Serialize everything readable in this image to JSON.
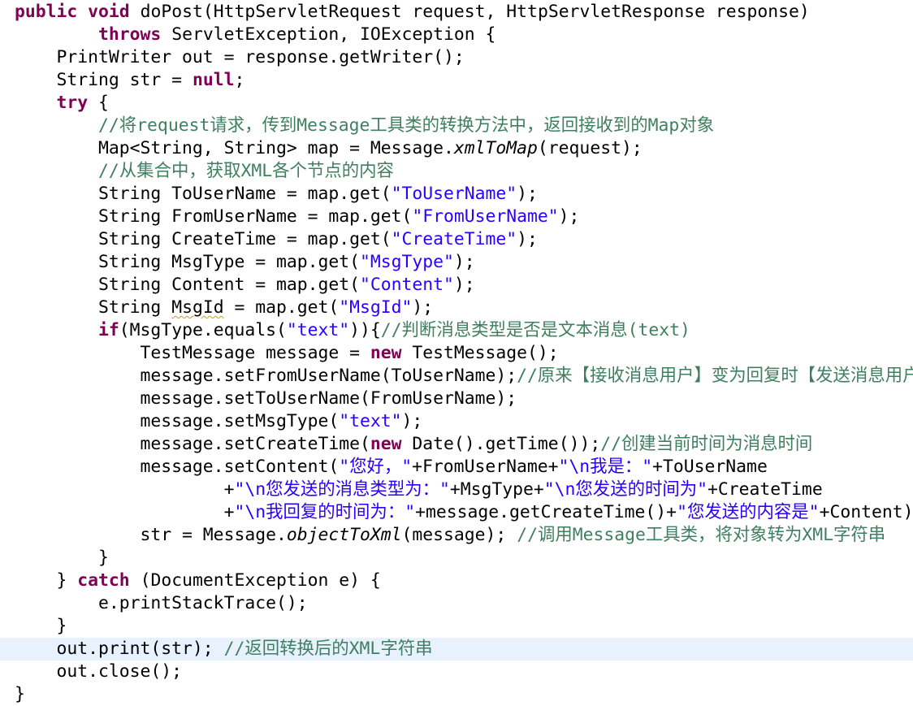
{
  "editor": {
    "language": "java",
    "current_line": 28,
    "colors": {
      "keyword": "#7f0055",
      "string": "#2a00ff",
      "comment": "#3f7f5f",
      "plain": "#000000",
      "current_line_bg": "#e8f2fe"
    },
    "lines": [
      [
        {
          "c": "kw",
          "t": "public"
        },
        {
          "t": " "
        },
        {
          "c": "kw",
          "t": "void"
        },
        {
          "t": " doPost(HttpServletRequest request, HttpServletResponse response)"
        }
      ],
      [
        {
          "t": "        "
        },
        {
          "c": "kw",
          "t": "throws"
        },
        {
          "t": " ServletException, IOException {"
        }
      ],
      [
        {
          "t": "    PrintWriter out = response.getWriter();"
        }
      ],
      [
        {
          "t": "    String str = "
        },
        {
          "c": "kw",
          "t": "null"
        },
        {
          "t": ";"
        }
      ],
      [
        {
          "t": "    "
        },
        {
          "c": "kw",
          "t": "try"
        },
        {
          "t": " {"
        }
      ],
      [
        {
          "t": "        "
        },
        {
          "c": "cmt",
          "t": "//将request请求，传到Message工具类的转换方法中，返回接收到的Map对象"
        }
      ],
      [
        {
          "t": "        Map<String, String> map = Message."
        },
        {
          "c": "it",
          "t": "xmlToMap"
        },
        {
          "t": "(request);"
        }
      ],
      [
        {
          "t": "        "
        },
        {
          "c": "cmt",
          "t": "//从集合中，获取XML各个节点的内容"
        }
      ],
      [
        {
          "t": "        String ToUserName = map.get("
        },
        {
          "c": "str",
          "t": "\"ToUserName\""
        },
        {
          "t": ");"
        }
      ],
      [
        {
          "t": "        String FromUserName = map.get("
        },
        {
          "c": "str",
          "t": "\"FromUserName\""
        },
        {
          "t": ");"
        }
      ],
      [
        {
          "t": "        String CreateTime = map.get("
        },
        {
          "c": "str",
          "t": "\"CreateTime\""
        },
        {
          "t": ");"
        }
      ],
      [
        {
          "t": "        String MsgType = map.get("
        },
        {
          "c": "str",
          "t": "\"MsgType\""
        },
        {
          "t": ");"
        }
      ],
      [
        {
          "t": "        String Content = map.get("
        },
        {
          "c": "str",
          "t": "\"Content\""
        },
        {
          "t": ");"
        }
      ],
      [
        {
          "t": "        String "
        },
        {
          "c": "warn",
          "t": "MsgId"
        },
        {
          "t": " = map.get("
        },
        {
          "c": "str",
          "t": "\"MsgId\""
        },
        {
          "t": ");"
        }
      ],
      [
        {
          "t": "        "
        },
        {
          "c": "kw",
          "t": "if"
        },
        {
          "t": "(MsgType.equals("
        },
        {
          "c": "str",
          "t": "\"text\""
        },
        {
          "t": ")){"
        },
        {
          "c": "cmt",
          "t": "//判断消息类型是否是文本消息(text)"
        }
      ],
      [
        {
          "t": "            TestMessage message = "
        },
        {
          "c": "kw",
          "t": "new"
        },
        {
          "t": " TestMessage();"
        }
      ],
      [
        {
          "t": "            message.setFromUserName(ToUserName);"
        },
        {
          "c": "cmt",
          "t": "//原来【接收消息用户】变为回复时【发送消息用户】"
        }
      ],
      [
        {
          "t": "            message.setToUserName(FromUserName);"
        }
      ],
      [
        {
          "t": "            message.setMsgType("
        },
        {
          "c": "str",
          "t": "\"text\""
        },
        {
          "t": ");"
        }
      ],
      [
        {
          "t": "            message.setCreateTime("
        },
        {
          "c": "kw",
          "t": "new"
        },
        {
          "t": " Date().getTime());"
        },
        {
          "c": "cmt",
          "t": "//创建当前时间为消息时间"
        }
      ],
      [
        {
          "t": "            message.setContent("
        },
        {
          "c": "str",
          "t": "\"您好，\""
        },
        {
          "t": "+FromUserName+"
        },
        {
          "c": "str",
          "t": "\"\\n我是：\""
        },
        {
          "t": "+ToUserName"
        }
      ],
      [
        {
          "t": "                    +"
        },
        {
          "c": "str",
          "t": "\"\\n您发送的消息类型为：\""
        },
        {
          "t": "+MsgType+"
        },
        {
          "c": "str",
          "t": "\"\\n您发送的时间为\""
        },
        {
          "t": "+CreateTime"
        }
      ],
      [
        {
          "t": "                    +"
        },
        {
          "c": "str",
          "t": "\"\\n我回复的时间为：\""
        },
        {
          "t": "+message.getCreateTime()+"
        },
        {
          "c": "str",
          "t": "\"您发送的内容是\""
        },
        {
          "t": "+Content);"
        }
      ],
      [
        {
          "t": "            str = Message."
        },
        {
          "c": "it",
          "t": "objectToXml"
        },
        {
          "t": "(message); "
        },
        {
          "c": "cmt",
          "t": "//调用Message工具类，将对象转为XML字符串"
        }
      ],
      [
        {
          "t": "        }"
        }
      ],
      [
        {
          "t": "    } "
        },
        {
          "c": "kw",
          "t": "catch"
        },
        {
          "t": " (DocumentException e) {"
        }
      ],
      [
        {
          "t": "        e.printStackTrace();"
        }
      ],
      [
        {
          "t": "    }"
        }
      ],
      [
        {
          "t": "    out.print(str); "
        },
        {
          "c": "cmt",
          "t": "//返回转换后的XML字符串"
        }
      ],
      [
        {
          "t": "    out.close();"
        }
      ],
      [
        {
          "t": "}"
        }
      ]
    ]
  }
}
